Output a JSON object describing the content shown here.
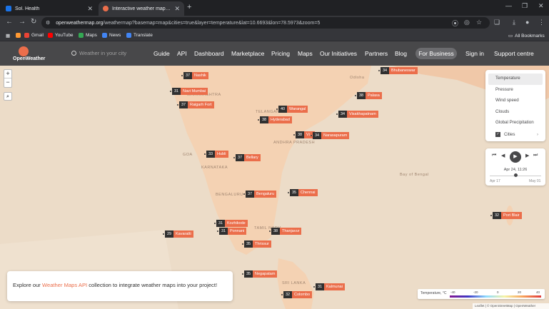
{
  "browser": {
    "tabs": [
      {
        "title": "Sol. Health",
        "favicon_color": "#1a73e8",
        "active": false
      },
      {
        "title": "Interactive weather maps - Ope",
        "favicon_color": "#eb6e4b",
        "active": true
      }
    ],
    "new_tab": "+",
    "window_controls": [
      "—",
      "❐",
      "✕"
    ],
    "url_host": "openweathermap.org",
    "url_path": "/weathermap?basemap=map&cities=true&layer=temperature&lat=10.6693&lon=78.5973&zoom=5",
    "bookmarks": [
      {
        "label": "Gmail",
        "color": "#ea4335"
      },
      {
        "label": "YouTube",
        "color": "#ff0000"
      },
      {
        "label": "Maps",
        "color": "#34a853"
      },
      {
        "label": "News",
        "color": "#4285f4"
      },
      {
        "label": "Translate",
        "color": "#4285f4"
      }
    ],
    "all_bookmarks": "All Bookmarks"
  },
  "site": {
    "brand": "OpenWeather",
    "search_placeholder": "Weather in your city",
    "nav": [
      "Guide",
      "API",
      "Dashboard",
      "Marketplace",
      "Pricing",
      "Maps",
      "Our Initiatives",
      "Partners",
      "Blog"
    ],
    "for_business": "For Business",
    "sign_in": "Sign in",
    "support": "Support centre"
  },
  "map": {
    "zoom_in": "+",
    "zoom_out": "−",
    "labels": [
      {
        "text": "MAHARASHTRA"
      },
      {
        "text": "TELANGANA"
      },
      {
        "text": "ANDHRA PRADESH"
      },
      {
        "text": "GOA"
      },
      {
        "text": "KARNATAKA"
      },
      {
        "text": "BENGALURU"
      },
      {
        "text": "TAMIL NADU"
      },
      {
        "text": "SRI LANKA"
      },
      {
        "text": "Bay of Bengal"
      },
      {
        "text": "Odisha"
      }
    ],
    "cities": [
      {
        "temp": "37",
        "name": "Nashik"
      },
      {
        "temp": "31",
        "name": "Navi Mumbai"
      },
      {
        "temp": "37",
        "name": "Raigarh Fort"
      },
      {
        "temp": "40",
        "name": "Warangal"
      },
      {
        "temp": "38",
        "name": "Hyderabad"
      },
      {
        "temp": "34",
        "name": "Bhubaneswar"
      },
      {
        "temp": "38",
        "name": "Palasa"
      },
      {
        "temp": "34",
        "name": "Visakhapatnam"
      },
      {
        "temp": "38",
        "name": "Vi..."
      },
      {
        "temp": "34",
        "name": "Narasapuram"
      },
      {
        "temp": "33",
        "name": "Hubli"
      },
      {
        "temp": "37",
        "name": "Bellary"
      },
      {
        "temp": "37",
        "name": "Bengaluru"
      },
      {
        "temp": "35",
        "name": "Chennai"
      },
      {
        "temp": "31",
        "name": "Kozhikode"
      },
      {
        "temp": "31",
        "name": "Ponnani"
      },
      {
        "temp": "38",
        "name": "Thanjavur"
      },
      {
        "temp": "29",
        "name": "Kavaratti"
      },
      {
        "temp": "35",
        "name": "Thrissur"
      },
      {
        "temp": "35",
        "name": "Negapatam"
      },
      {
        "temp": "31",
        "name": "Kalmunai"
      },
      {
        "temp": "32",
        "name": "Colombo"
      },
      {
        "temp": "32",
        "name": "Port Blair"
      }
    ],
    "layers": [
      {
        "label": "Temperature",
        "selected": true
      },
      {
        "label": "Pressure"
      },
      {
        "label": "Wind speed"
      },
      {
        "label": "Clouds"
      },
      {
        "label": "Global Precipitation"
      }
    ],
    "cities_toggle": {
      "label": "Cities",
      "checked": true
    },
    "player": {
      "date": "Apr 24, 11:26",
      "start": "Apr 17",
      "end": "May 01",
      "progress": 0.5
    },
    "promo_prefix": "Explore our ",
    "promo_link": "Weather Maps API",
    "promo_suffix": " collection to integrate weather maps into your project!",
    "legend": {
      "title": "Temperature, °C",
      "ticks": [
        "-40",
        "-20",
        "0",
        "20",
        "40"
      ]
    },
    "attribution": "Leaflet | © OpenStreetMap | OpenWeather"
  }
}
